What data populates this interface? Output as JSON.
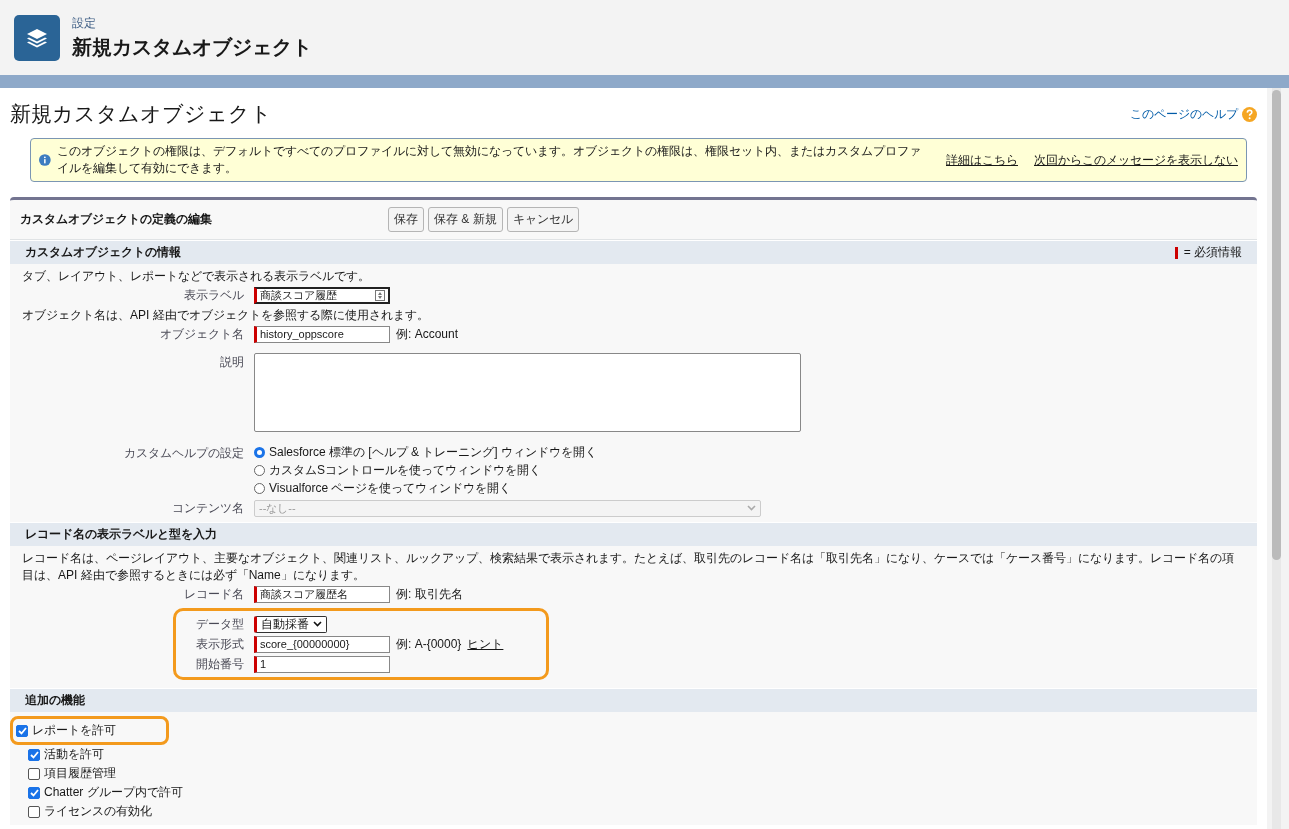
{
  "header": {
    "breadcrumb": "設定",
    "title": "新規カスタムオブジェクト"
  },
  "page_title": "新規カスタムオブジェクト",
  "help_link": "このページのヘルプ",
  "info": {
    "text": "このオブジェクトの権限は、デフォルトですべてのプロファイルに対して無効になっています。オブジェクトの権限は、権限セット内、またはカスタムプロファイルを編集して有効にできます。",
    "links": [
      "詳細はこちら",
      "次回からこのメッセージを表示しない"
    ]
  },
  "edit_block": {
    "title": "カスタムオブジェクトの定義の編集",
    "buttons": [
      "保存",
      "保存 & 新規",
      "キャンセル"
    ]
  },
  "sections": [
    {
      "title": "カスタムオブジェクトの情報",
      "required_legend": "= 必須情報",
      "items": [
        {
          "kind": "note",
          "text": "タブ、レイアウト、レポートなどで表示される表示ラベルです。"
        },
        {
          "kind": "field",
          "label": "表示ラベル",
          "value": "商談スコア履歴",
          "required": true,
          "focused": true
        },
        {
          "kind": "note",
          "text": "オブジェクト名は、API 経由でオブジェクトを参照する際に使用されます。"
        },
        {
          "kind": "field",
          "label": "オブジェクト名",
          "value": "history_oppscore",
          "required": true,
          "focused": false,
          "hint": "例:  Account"
        },
        {
          "kind": "textarea",
          "label": "説明"
        },
        {
          "kind": "radio",
          "label": "カスタムヘルプの設定",
          "options": [
            {
              "label": "Salesforce 標準の [ヘルプ & トレーニング] ウィンドウを開く",
              "selected": true
            },
            {
              "label": "カスタムSコントロールを使ってウィンドウを開く",
              "selected": false
            },
            {
              "label": "Visualforce ページを使ってウィンドウを開く",
              "selected": false
            }
          ]
        },
        {
          "kind": "select",
          "label": "コンテンツ名",
          "value": "--なし--",
          "required": false,
          "disabled": true
        }
      ]
    },
    {
      "title": "レコード名の表示ラベルと型を入力",
      "items": [
        {
          "kind": "note",
          "text": "レコード名は、ページレイアウト、主要なオブジェクト、関連リスト、ルックアップ、検索結果で表示されます。たとえば、取引先のレコード名は「取引先名」になり、ケースでは「ケース番号」になります。レコード名の項目は、API 経由で参照するときには必ず「Name」になります。"
        },
        {
          "kind": "field",
          "label": "レコード名",
          "value": "商談スコア履歴名",
          "required": true,
          "focused": false,
          "hint": "例:  取引先名"
        },
        {
          "kind": "group",
          "highlighted": true,
          "items": [
            {
              "kind": "select",
              "label": "データ型",
              "value": "自動採番",
              "required": true,
              "disabled": false
            },
            {
              "kind": "field",
              "label": "表示形式",
              "value": "score_{00000000}",
              "required": true,
              "focused": false,
              "hint": "例:  A-{0000}",
              "link": "ヒント"
            },
            {
              "kind": "field",
              "label": "開始番号",
              "value": "1",
              "required": true,
              "focused": false
            }
          ]
        }
      ]
    },
    {
      "title": "追加の機能",
      "items": [
        {
          "kind": "checkbox",
          "label": "レポートを許可",
          "checked": true,
          "highlighted": true
        },
        {
          "kind": "checkbox",
          "label": "活動を許可",
          "checked": true,
          "highlighted": false
        },
        {
          "kind": "checkbox",
          "label": "項目履歴管理",
          "checked": false,
          "highlighted": false
        },
        {
          "kind": "checkbox",
          "label": "Chatter グループ内で許可",
          "checked": true,
          "highlighted": false
        },
        {
          "kind": "checkbox",
          "label": "ライセンスの有効化",
          "checked": false,
          "highlighted": false
        }
      ]
    }
  ]
}
